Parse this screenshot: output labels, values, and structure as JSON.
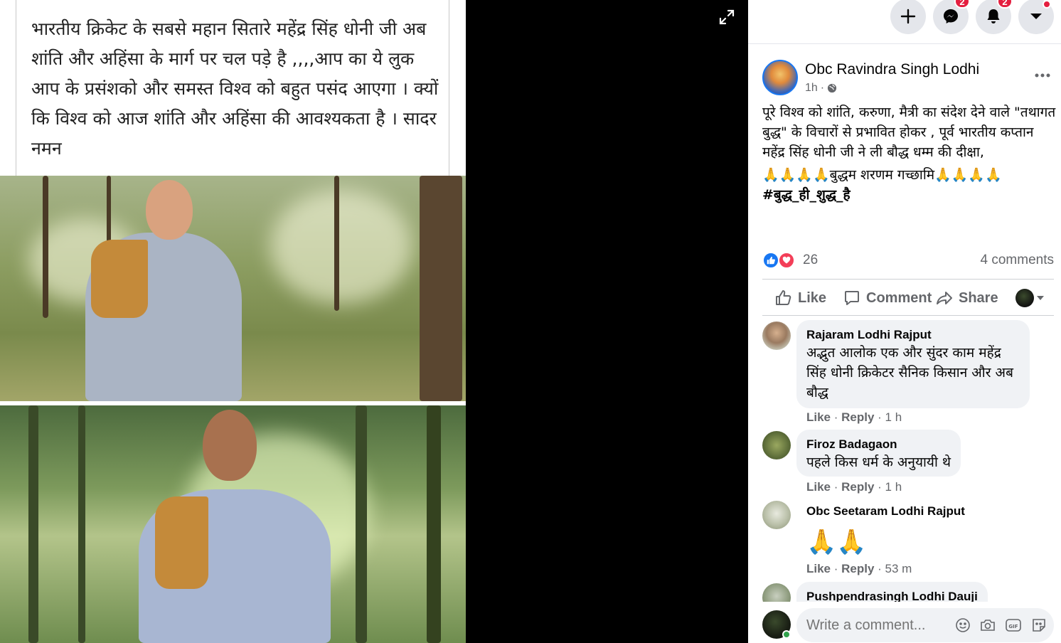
{
  "media": {
    "quote_text": "भारतीय क्रिकेट के सबसे महान सितारे महेंद्र सिंह धोनी जी अब शांति और अहिंसा के मार्ग पर चल पड़े है ,,,,आप का ये लुक आप के प्रसंशको और समस्त विश्व को बहुत पसंद आएगा । क्यों कि विश्व को आज शांति और अहिंसा की आवश्यकता है । सादर नमन",
    "expand_icon": "expand-icon"
  },
  "topbar": {
    "messenger_badge": "2",
    "notifications_badge": "2"
  },
  "post": {
    "author": "Obc Ravindra Singh Lodhi",
    "time": "1h",
    "time_sep": "·",
    "text_p1": "पूरे विश्व को शांति, करुणा, मैत्री का संदेश देने वाले \"तथागत बुद्ध\" के विचारों से प्रभावित होकर , पूर्व भारतीय कप्तान महेंद्र सिंह धोनी जी ने ली बौद्ध धम्म की दीक्षा,",
    "text_p2": "🙏🙏🙏🙏बुद्धम शरणम गच्छामि🙏🙏🙏🙏",
    "hashtag": "#बुद्ध_ही_शुद्ध_है",
    "reaction_count": "26",
    "comments_count": "4 comments"
  },
  "actions": {
    "like": "Like",
    "comment": "Comment",
    "share": "Share"
  },
  "comments": [
    {
      "name": "Rajaram Lodhi Rajput",
      "text": "अद्भुत आलोक एक और सुंदर काम महेंद्र सिंह धोनी क्रिकेटर सैनिक किसान और अब बौद्ध",
      "like": "Like",
      "reply": "Reply",
      "time": "1 h"
    },
    {
      "name": "Firoz Badagaon",
      "text": "पहले किस धर्म के अनुयायी थे",
      "like": "Like",
      "reply": "Reply",
      "time": "1 h"
    },
    {
      "name": "Obc Seetaram Lodhi Rajput",
      "text": "🙏🙏",
      "like": "Like",
      "reply": "Reply",
      "time": "53 m"
    },
    {
      "name": "Pushpendrasingh Lodhi Dauji"
    }
  ],
  "composer": {
    "placeholder": "Write a comment..."
  }
}
